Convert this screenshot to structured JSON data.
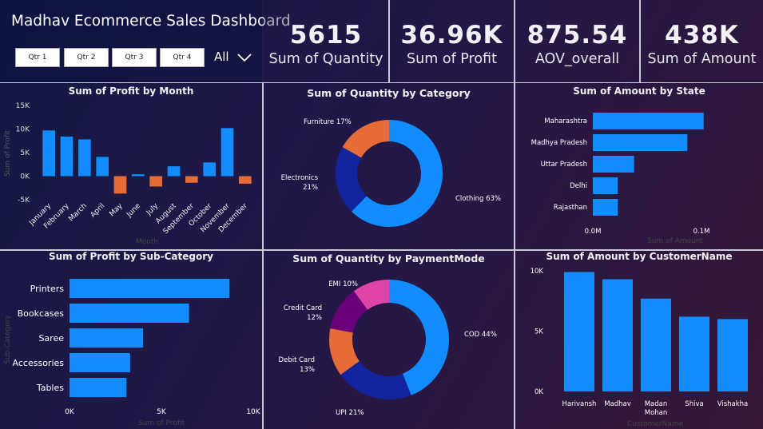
{
  "header": {
    "title": "Madhav Ecommerce Sales Dashboard",
    "quarters": [
      "Qtr 1",
      "Qtr 2",
      "Qtr 3",
      "Qtr 4"
    ],
    "dropdown_value": "All"
  },
  "kpis": [
    {
      "value": "5615",
      "label": "Sum of Quantity"
    },
    {
      "value": "36.96K",
      "label": "Sum of Profit"
    },
    {
      "value": "875.54",
      "label": "AOV_overall"
    },
    {
      "value": "438K",
      "label": "Sum of Amount"
    }
  ],
  "colors": {
    "blue": "#118DFF",
    "orange": "#E66C37",
    "navy": "#12239E",
    "purple": "#6B007B",
    "pink": "#E044A7"
  },
  "chart_data": [
    {
      "id": "profit_by_month",
      "type": "bar",
      "title": "Sum of Profit by Month",
      "xlabel": "Month",
      "ylabel": "Sum of Profit",
      "categories": [
        "January",
        "February",
        "March",
        "April",
        "May",
        "June",
        "July",
        "August",
        "September",
        "October",
        "November",
        "December"
      ],
      "values": [
        9700,
        8400,
        7800,
        4100,
        -3700,
        400,
        -2200,
        2100,
        -1400,
        2900,
        10200,
        -1600
      ],
      "ylim": [
        -5000,
        15000
      ],
      "yticks": [
        "15K",
        "10K",
        "5K",
        "0K",
        "-5K"
      ]
    },
    {
      "id": "quantity_by_category",
      "type": "pie",
      "title": "Sum of Quantity by Category",
      "categories": [
        "Clothing",
        "Electronics",
        "Furniture"
      ],
      "values": [
        63,
        21,
        17
      ],
      "labels": [
        "Clothing 63%",
        "Electronics",
        "21%",
        "Furniture 17%"
      ]
    },
    {
      "id": "amount_by_state",
      "type": "bar",
      "title": "Sum of Amount by State",
      "xlabel": "Sum of Amount",
      "categories": [
        "Maharashtra",
        "Madhya Pradesh",
        "Uttar Pradesh",
        "Delhi",
        "Rajasthan"
      ],
      "values": [
        102000,
        87000,
        38000,
        23000,
        23000
      ],
      "xlim": [
        0,
        150000
      ],
      "xticks": [
        "0.0M",
        "0.1M"
      ]
    },
    {
      "id": "profit_by_subcategory",
      "type": "bar",
      "title": "Sum of Profit by Sub-Category",
      "xlabel": "Sum of Profit",
      "ylabel": "Sub-Category",
      "categories": [
        "Printers",
        "Bookcases",
        "Saree",
        "Accessories",
        "Tables"
      ],
      "values": [
        8700,
        6500,
        4000,
        3300,
        3100
      ],
      "xlim": [
        0,
        10000
      ],
      "xticks": [
        "0K",
        "5K",
        "10K"
      ]
    },
    {
      "id": "quantity_by_paymentmode",
      "type": "pie",
      "title": "Sum of Quantity by PaymentMode",
      "categories": [
        "COD",
        "UPI",
        "Debit Card",
        "Credit Card",
        "EMI"
      ],
      "values": [
        44,
        21,
        13,
        12,
        10
      ],
      "labels": [
        "COD 44%",
        "UPI 21%",
        "Debit Card",
        "13%",
        "Credit Card",
        "12%",
        "EMI 10%"
      ]
    },
    {
      "id": "amount_by_customer",
      "type": "bar",
      "title": "Sum of Amount by CustomerName",
      "xlabel": "CustomerName",
      "categories": [
        "Harivansh",
        "Madhav",
        "Madan Mohan",
        "Shiva",
        "Vishakha"
      ],
      "values": [
        9900,
        9300,
        7700,
        6200,
        6000
      ],
      "ylim": [
        0,
        10000
      ],
      "yticks": [
        "10K",
        "5K",
        "0K"
      ]
    }
  ]
}
